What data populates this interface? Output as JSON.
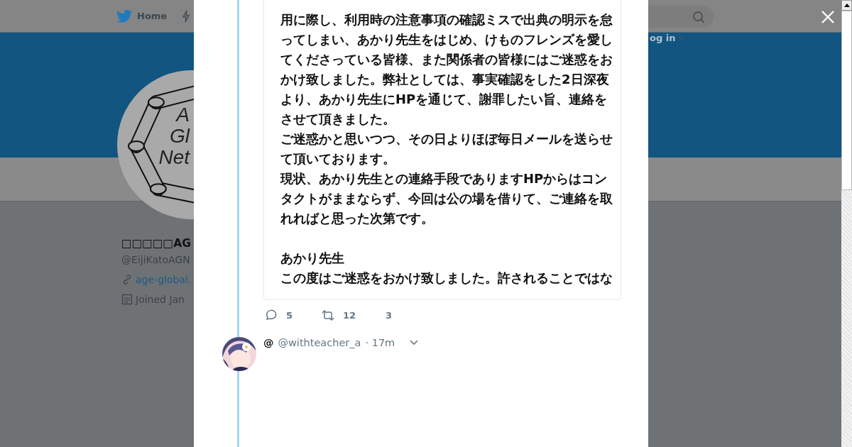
{
  "nav": {
    "home": "Home",
    "login": "og in"
  },
  "profile": {
    "logo_text": [
      "A",
      "Gl",
      "Net"
    ],
    "name": "□□□□□AG",
    "handle": "@EijiKatoAGN",
    "website": "age-global.",
    "joined": "Joined Jan"
  },
  "tweet": {
    "lines": [
      {
        "text": "用に際し、利用時の注意事項の確認ミスで出典の明示を怠",
        "gap_before": false
      },
      {
        "text": "ってしまい、あかり先生をはじめ、けものフレンズを愛し",
        "gap_before": false
      },
      {
        "text": "てくださっている皆様、また関係者の皆様にはご迷惑をお",
        "gap_before": false
      },
      {
        "text": "かけ致しました。弊社としては、事実確認をした2日深夜",
        "gap_before": false
      },
      {
        "text": "より、あかり先生にHPを通じて、謝罪したい旨、連絡を",
        "gap_before": false
      },
      {
        "text": "させて頂きました。",
        "gap_before": false
      },
      {
        "text": "ご迷惑かと思いつつ、その日よりほぼ毎日メールを送らせ",
        "gap_before": false
      },
      {
        "text": "て頂いております。",
        "gap_before": false
      },
      {
        "text": "現状、あかり先生との連絡手段でありますHPからはコン",
        "gap_before": false
      },
      {
        "text": "タクトがままならず、今回は公の場を借りて、ご連絡を取",
        "gap_before": false
      },
      {
        "text": "れればと思った次第です。",
        "gap_before": false
      },
      {
        "text": "あかり先生",
        "gap_before": true
      },
      {
        "text": "この度はご迷惑をおかけ致しました。許されることではな",
        "gap_before": false
      }
    ],
    "replies": "5",
    "retweets": "12",
    "likes": "3"
  },
  "reply": {
    "name": "@",
    "handle": "@withteacher_a",
    "time": "· 17m"
  }
}
